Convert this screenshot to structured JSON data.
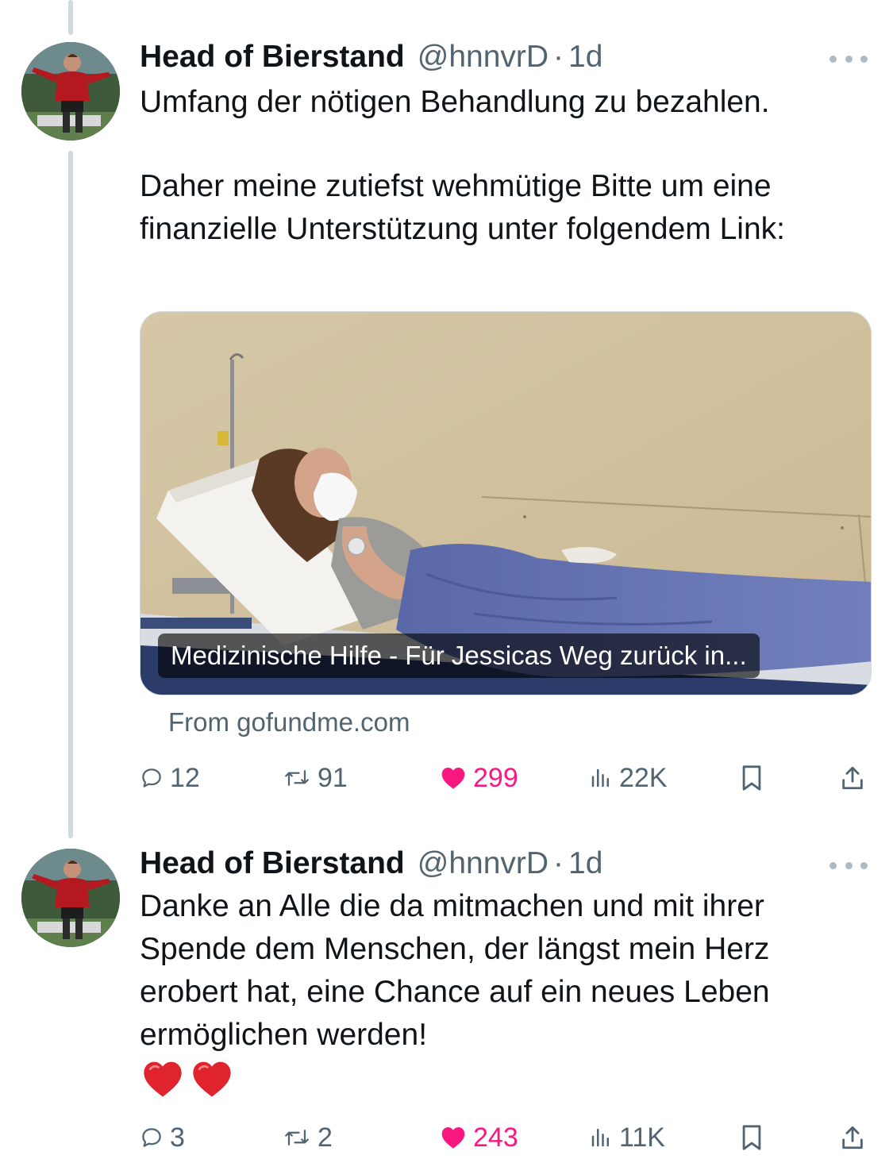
{
  "colors": {
    "like": "#f91880",
    "muted": "#536471",
    "thread": "#cfd9de",
    "heart_emoji": "#e0242d"
  },
  "tweets": [
    {
      "author": {
        "name": "Head of Bierstand",
        "handle": "@hnnvrD",
        "separator": "·",
        "time": "1d",
        "avatar_icon": "football-player-avatar"
      },
      "paragraphs": [
        "Umfang der nötigen Behandlung zu bezahlen.",
        "Daher meine zutiefst wehmütige Bitte um eine finanzielle Unterstützung unter folgendem Link:"
      ],
      "card": {
        "title": "Medizinische Hilfe - Für Jessicas Weg zurück in...",
        "source": "From gofundme.com",
        "image": "woman-resting-on-hospital-bed"
      },
      "stats": {
        "replies": "12",
        "reposts": "91",
        "likes": "299",
        "views": "22K"
      },
      "liked": true
    },
    {
      "author": {
        "name": "Head of Bierstand",
        "handle": "@hnnvrD",
        "separator": "·",
        "time": "1d",
        "avatar_icon": "football-player-avatar"
      },
      "paragraphs": [
        "Danke an Alle die da mitmachen und mit ihrer Spende dem Menschen, der längst mein Herz erobert hat, eine Chance auf ein neues Leben ermöglichen werden!"
      ],
      "emoji": [
        "red-heart",
        "red-heart"
      ],
      "stats": {
        "replies": "3",
        "reposts": "2",
        "likes": "243",
        "views": "11K"
      },
      "liked": true
    }
  ]
}
